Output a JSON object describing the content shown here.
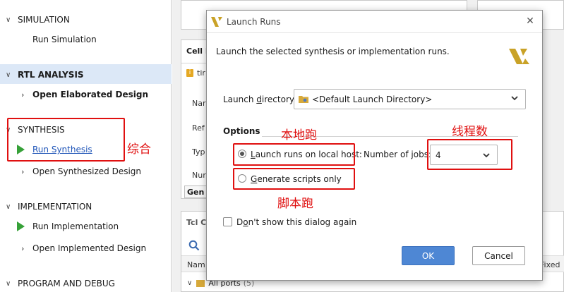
{
  "navigator": {
    "simulation": {
      "header": "SIMULATION",
      "run_simulation": "Run Simulation"
    },
    "rtl_analysis": {
      "header": "RTL ANALYSIS",
      "open_elaborated": "Open Elaborated Design"
    },
    "synthesis": {
      "header": "SYNTHESIS",
      "run_synthesis": "Run Synthesis",
      "open_synthesized": "Open Synthesized Design"
    },
    "implementation": {
      "header": "IMPLEMENTATION",
      "run_implementation": "Run Implementation",
      "open_implemented": "Open Implemented Design"
    },
    "program_debug": {
      "header": "PROGRAM AND DEBUG"
    }
  },
  "background": {
    "cell_tab": "Cell I",
    "cell_row": "tir",
    "props": [
      "Nar",
      "Ref",
      "Typ",
      "Nur"
    ],
    "gen_tab": "Gen",
    "tcl_tab": "Tcl C",
    "col_name": "Nam",
    "col_fixed": "Fixed",
    "all_ports": "All ports",
    "all_ports_count": "(5)"
  },
  "dialog": {
    "title": "Launch Runs",
    "description": "Launch the selected synthesis or implementation runs.",
    "launch_directory_label": "Launch directory:",
    "launch_directory_value": "<Default Launch Directory>",
    "options_header": "Options",
    "radio_local": "Launch runs on local host:",
    "jobs_label": "Number of jobs:",
    "jobs_value": "4",
    "radio_scripts": "Generate scripts only",
    "dont_show": "Don't show this dialog again",
    "ok": "OK",
    "cancel": "Cancel",
    "radio_local_selected": true
  },
  "annotations": {
    "synthesis_note": "综合",
    "local_note": "本地跑",
    "scripts_note": "脚本跑",
    "threads_note": "线程数",
    "color": "#e01010"
  },
  "colors": {
    "accent": "#4e87d4",
    "play": "#36a138",
    "selected_band": "#dce8f7",
    "logo": "#c9a227"
  }
}
